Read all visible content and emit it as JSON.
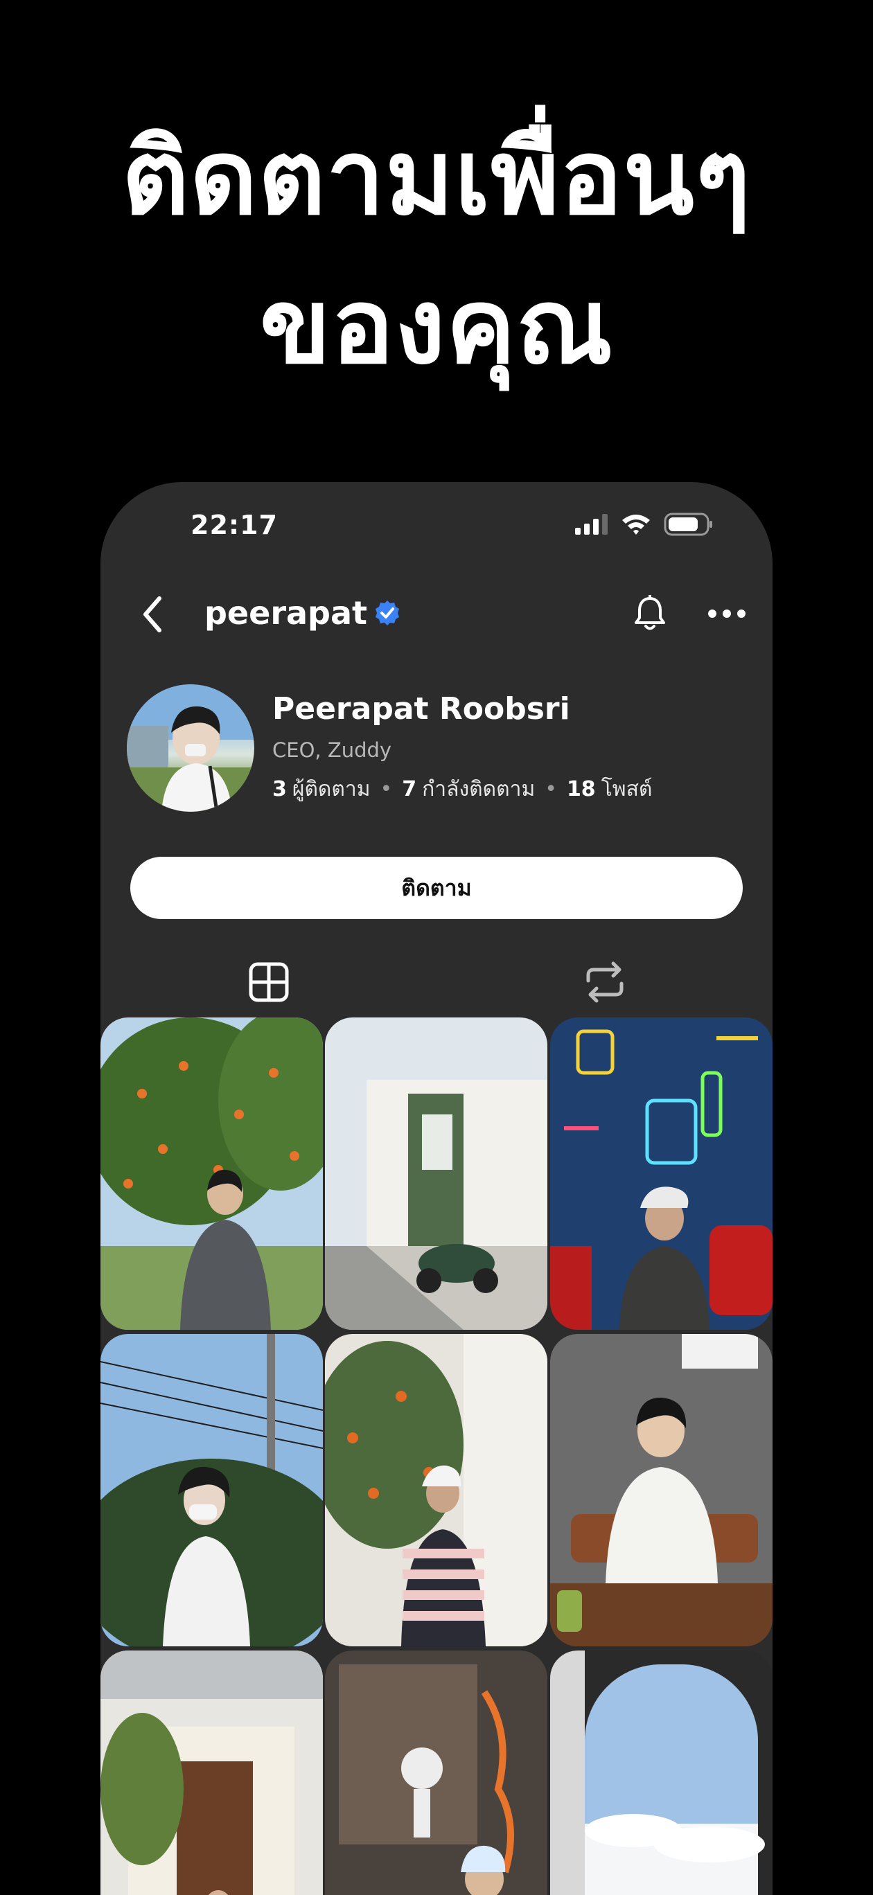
{
  "headline": {
    "line1": "ติดตามเพื่อนๆ",
    "line2": "ของคุณ"
  },
  "status_bar": {
    "time": "22:17"
  },
  "nav": {
    "username": "peerapat",
    "verified": true
  },
  "profile": {
    "name": "Peerapat Roobsri",
    "title": "CEO, Zuddy",
    "stats": [
      {
        "count": "3",
        "label": "ผู้ติดตาม"
      },
      {
        "count": "7",
        "label": "กำลังติดตาม"
      },
      {
        "count": "18",
        "label": "โพสต์"
      }
    ]
  },
  "follow_button": {
    "label": "ติดตาม"
  },
  "tabs": [
    {
      "icon": "grid-icon",
      "active": true
    },
    {
      "icon": "repost-icon",
      "active": false
    }
  ],
  "colors": {
    "background": "#000000",
    "phone_surface": "#2c2c2c",
    "verified_badge": "#3b82f6",
    "button_bg": "#ffffff",
    "secondary_text": "#b8b8b8"
  },
  "posts": [
    {
      "scene": "orange tree, man in grey shirt"
    },
    {
      "scene": "white house with green scooter"
    },
    {
      "scene": "neon pub wall, man in cap"
    },
    {
      "scene": "power lines, man with mask"
    },
    {
      "scene": "cafe wall with plants, striped shirt"
    },
    {
      "scene": "cafe table, man in white shirt"
    },
    {
      "scene": "shop front with trees"
    },
    {
      "scene": "halloween window, man in cap"
    },
    {
      "scene": "airplane window above clouds"
    }
  ]
}
